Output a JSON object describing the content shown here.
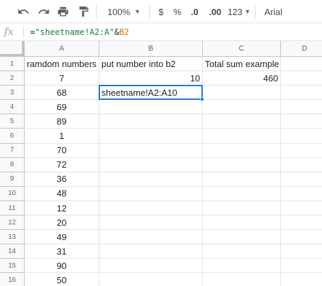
{
  "toolbar": {
    "zoom": "100%",
    "currency": "$",
    "percent": "%",
    "decrease_decimals": ".0",
    "increase_decimals": ".00",
    "more_formats": "123",
    "font": "Arial"
  },
  "formula_bar": {
    "fx": "fx",
    "formula_eq": "=",
    "formula_string": "\"sheetname!A2:A\"",
    "formula_amp": "&",
    "formula_ref": "B2"
  },
  "columns": [
    "A",
    "B",
    "C",
    "D"
  ],
  "rows": [
    "1",
    "2",
    "3",
    "4",
    "5",
    "6",
    "7",
    "8",
    "9",
    "10",
    "11",
    "12",
    "13",
    "14",
    "15",
    "16"
  ],
  "cells": {
    "A1": "ramdom numbers",
    "B1": "put number into b2",
    "C1": "Total sum example",
    "A2": "7",
    "B2": "10",
    "C2": "460",
    "A3": "68",
    "B3": "sheetname!A2:A10",
    "A4": "69",
    "A5": "89",
    "A6": "1",
    "A7": "70",
    "A8": "72",
    "A9": "36",
    "A10": "48",
    "A11": "12",
    "A12": "20",
    "A13": "49",
    "A14": "31",
    "A15": "90",
    "A16": "50"
  },
  "selected_cell": "B3",
  "colors": {
    "selection": "#1a73e8",
    "formula_string": "#188038",
    "formula_ref": "#e37400"
  }
}
